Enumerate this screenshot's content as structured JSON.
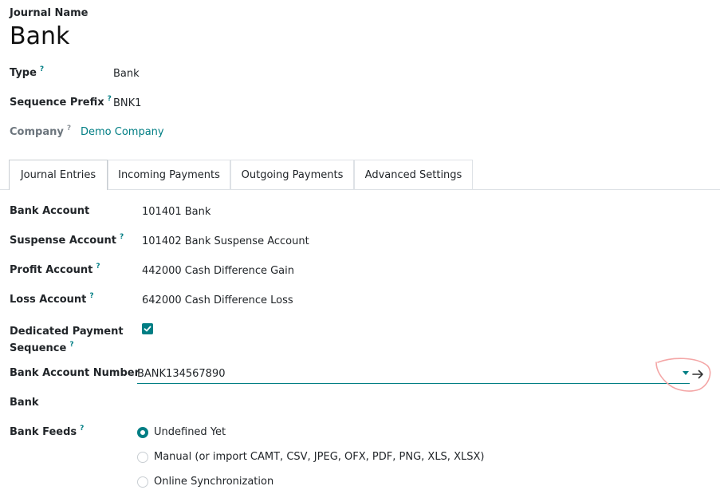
{
  "header": {
    "journal_name_label": "Journal Name",
    "title": "Bank"
  },
  "fields_top": {
    "type": {
      "label": "Type",
      "help": "?",
      "value": "Bank"
    },
    "sequence_prefix": {
      "label": "Sequence Prefix",
      "help": "?",
      "value": "BNK1"
    },
    "company": {
      "label": "Company",
      "help": "?",
      "value": "Demo Company"
    }
  },
  "tabs": [
    {
      "label": "Journal Entries",
      "active": true
    },
    {
      "label": "Incoming Payments",
      "active": false
    },
    {
      "label": "Outgoing Payments",
      "active": false
    },
    {
      "label": "Advanced Settings",
      "active": false
    }
  ],
  "journal_entries": {
    "bank_account": {
      "label": "Bank Account",
      "value": "101401 Bank"
    },
    "suspense_account": {
      "label": "Suspense Account",
      "help": "?",
      "value": "101402 Bank Suspense Account"
    },
    "profit_account": {
      "label": "Profit Account",
      "help": "?",
      "value": "442000 Cash Difference Gain"
    },
    "loss_account": {
      "label": "Loss Account",
      "help": "?",
      "value": "642000 Cash Difference Loss"
    },
    "dedicated_payment_sequence": {
      "label_line1": "Dedicated Payment",
      "label_line2": "Sequence",
      "help": "?",
      "checked": true
    },
    "bank_account_number": {
      "label": "Bank Account Number",
      "value": "BANK134567890"
    },
    "bank": {
      "label": "Bank"
    },
    "bank_feeds": {
      "label": "Bank Feeds",
      "help": "?",
      "options": [
        {
          "label": "Undefined Yet",
          "checked": true
        },
        {
          "label": "Manual (or import CAMT, CSV, JPEG, OFX, PDF, PNG, XLS, XLSX)",
          "checked": false
        },
        {
          "label": "Online Synchronization",
          "checked": false
        }
      ]
    }
  },
  "colors": {
    "accent": "#017e84",
    "annotation": "#f4a6a6"
  },
  "icons": {
    "dropdown": "caret-down-icon",
    "open_record": "arrow-right-icon",
    "check": "check-icon"
  }
}
